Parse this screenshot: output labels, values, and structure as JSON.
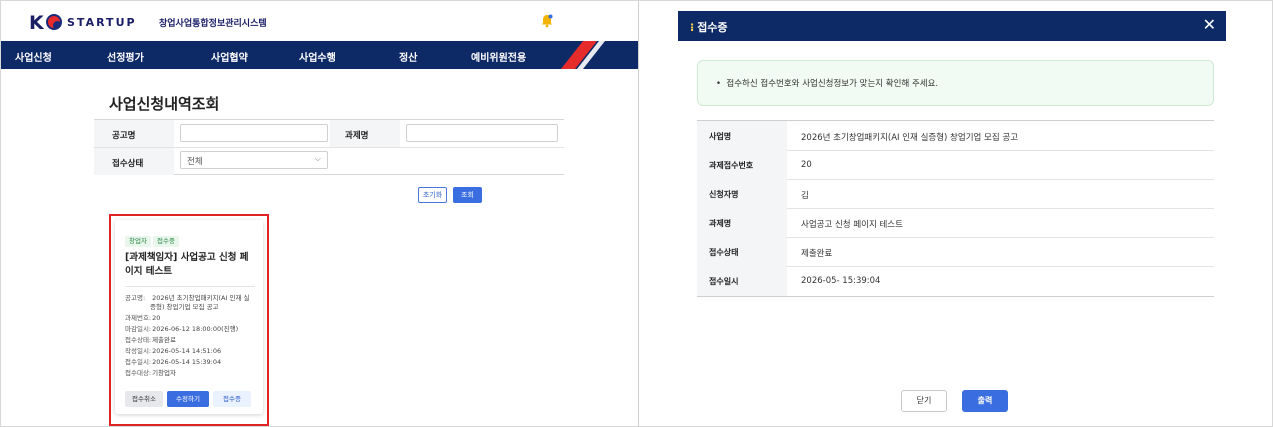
{
  "header": {
    "logo_text": "STARTUP",
    "system_name": "창업사업통합정보관리시스템"
  },
  "nav": {
    "items": [
      "사업신청",
      "선정평가",
      "사업협약",
      "사업수행",
      "정산",
      "예비위원전용"
    ]
  },
  "page": {
    "title": "사업신청내역조회"
  },
  "filter": {
    "notice_label": "공고명",
    "notice_value": "",
    "task_label": "과제명",
    "task_value": "",
    "status_label": "접수상태",
    "status_value": "전체",
    "reset_label": "초기화",
    "search_label": "조회"
  },
  "card": {
    "tags": [
      "창업자",
      "접수중"
    ],
    "title": "[과제책임자] 사업공고 신청 페이지 테스트",
    "info": [
      {
        "key": "공고명:",
        "value": "2026년 초기창업패키지(AI 인재 실"
      },
      {
        "key": "과제번호:",
        "value": "20"
      },
      {
        "key": "마감일시:",
        "value": "2026-06-12 18:00:00(진행)"
      },
      {
        "key": "접수상태:",
        "value": "제출완료"
      },
      {
        "key": "작성일시:",
        "value": "2026-05-14 14:51:06"
      },
      {
        "key": "접수일시:",
        "value": "2026-05-14 15:39:04"
      },
      {
        "key": "접수대상:",
        "value": "기창업자"
      }
    ],
    "notice_cont": "증형) 창업기업 모집 공고",
    "buttons": [
      "접수취소",
      "수정하기",
      "접수증"
    ]
  },
  "modal": {
    "title": "접수증",
    "notice": "접수하신 접수번호와 사업신청정보가 맞는지 확인해 주세요.",
    "rows": [
      {
        "label": "사업명",
        "value": "2026년 초기창업패키지(AI 인재 실증형) 창업기업 모집 공고"
      },
      {
        "label": "과제접수번호",
        "value": "20"
      },
      {
        "label": "신청자명",
        "value": "김"
      },
      {
        "label": "과제명",
        "value": "사업공고 신청 페이지 테스트"
      },
      {
        "label": "접수상태",
        "value": "제출완료"
      },
      {
        "label": "접수일시",
        "value": "2026-05-   15:39:04"
      }
    ],
    "close_label": "닫기",
    "print_label": "출력"
  },
  "colors": {
    "navy": "#0e2a66",
    "primary": "#3a6ee0",
    "highlight": "#e02424",
    "accent_red": "#e62b2b"
  }
}
